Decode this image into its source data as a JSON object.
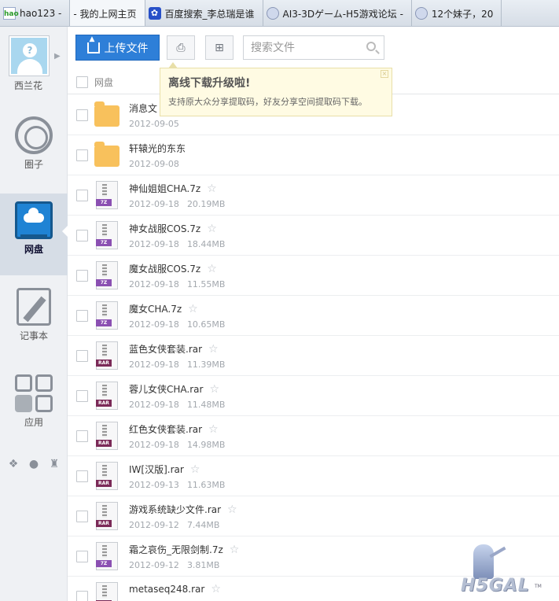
{
  "tabs": [
    {
      "icon": "hao-icon",
      "label": "hao123 -"
    },
    {
      "icon": "",
      "label": "- 我的上网主页"
    },
    {
      "icon": "paw-icon",
      "label": "百度搜索_李总瑞是谁"
    },
    {
      "icon": "anime-icon",
      "label": "AI3-3Dゲーム-H5游戏论坛 -"
    },
    {
      "icon": "anime-icon",
      "label": "12个妹子，20"
    }
  ],
  "sidebar": {
    "username": "西兰花",
    "nav": [
      {
        "label": "圈子",
        "icon": "circle-icon",
        "active": false
      },
      {
        "label": "网盘",
        "icon": "cloud-monitor-icon",
        "active": true
      },
      {
        "label": "记事本",
        "icon": "notepad-icon",
        "active": false
      },
      {
        "label": "应用",
        "icon": "apps-grid-icon",
        "active": false
      }
    ],
    "os_icons": [
      "windows-icon",
      "apple-icon",
      "android-icon"
    ]
  },
  "toolbar": {
    "upload_label": "上传文件",
    "search_placeholder": "搜索文件"
  },
  "list_header": {
    "label": "网盘"
  },
  "tooltip": {
    "title": "离线下载升级啦!",
    "desc": "支持原大众分享提取码，好友分享空间提取码下载。"
  },
  "files": [
    {
      "name": "消息文",
      "date": "2012-09-05",
      "size": "",
      "type": "folder"
    },
    {
      "name": "轩辕光的东东",
      "date": "2012-09-08",
      "size": "",
      "type": "folder"
    },
    {
      "name": "神仙姐姐CHA.7z",
      "date": "2012-09-18",
      "size": "20.19MB",
      "type": "7z"
    },
    {
      "name": "神女战服COS.7z",
      "date": "2012-09-18",
      "size": "18.44MB",
      "type": "7z"
    },
    {
      "name": "魔女战服COS.7z",
      "date": "2012-09-18",
      "size": "11.55MB",
      "type": "7z"
    },
    {
      "name": "魔女CHA.7z",
      "date": "2012-09-18",
      "size": "10.65MB",
      "type": "7z"
    },
    {
      "name": "蓝色女侠套装.rar",
      "date": "2012-09-18",
      "size": "11.39MB",
      "type": "rar"
    },
    {
      "name": "蓉儿女侠CHA.rar",
      "date": "2012-09-18",
      "size": "11.48MB",
      "type": "rar"
    },
    {
      "name": "红色女侠套装.rar",
      "date": "2012-09-18",
      "size": "14.98MB",
      "type": "rar"
    },
    {
      "name": "IW[汉版].rar",
      "date": "2012-09-13",
      "size": "11.63MB",
      "type": "rar"
    },
    {
      "name": "游戏系统缺少文件.rar",
      "date": "2012-09-12",
      "size": "7.44MB",
      "type": "rar"
    },
    {
      "name": "霜之哀伤_无限剑制.7z",
      "date": "2012-09-12",
      "size": "3.81MB",
      "type": "7z"
    },
    {
      "name": "metaseq248.rar",
      "date": "",
      "size": "",
      "type": "rar"
    }
  ],
  "file_type_tags": {
    "7z": "7Z",
    "rar": "RAR"
  },
  "watermark": {
    "text": "H5GAL",
    "tm": "TM"
  }
}
